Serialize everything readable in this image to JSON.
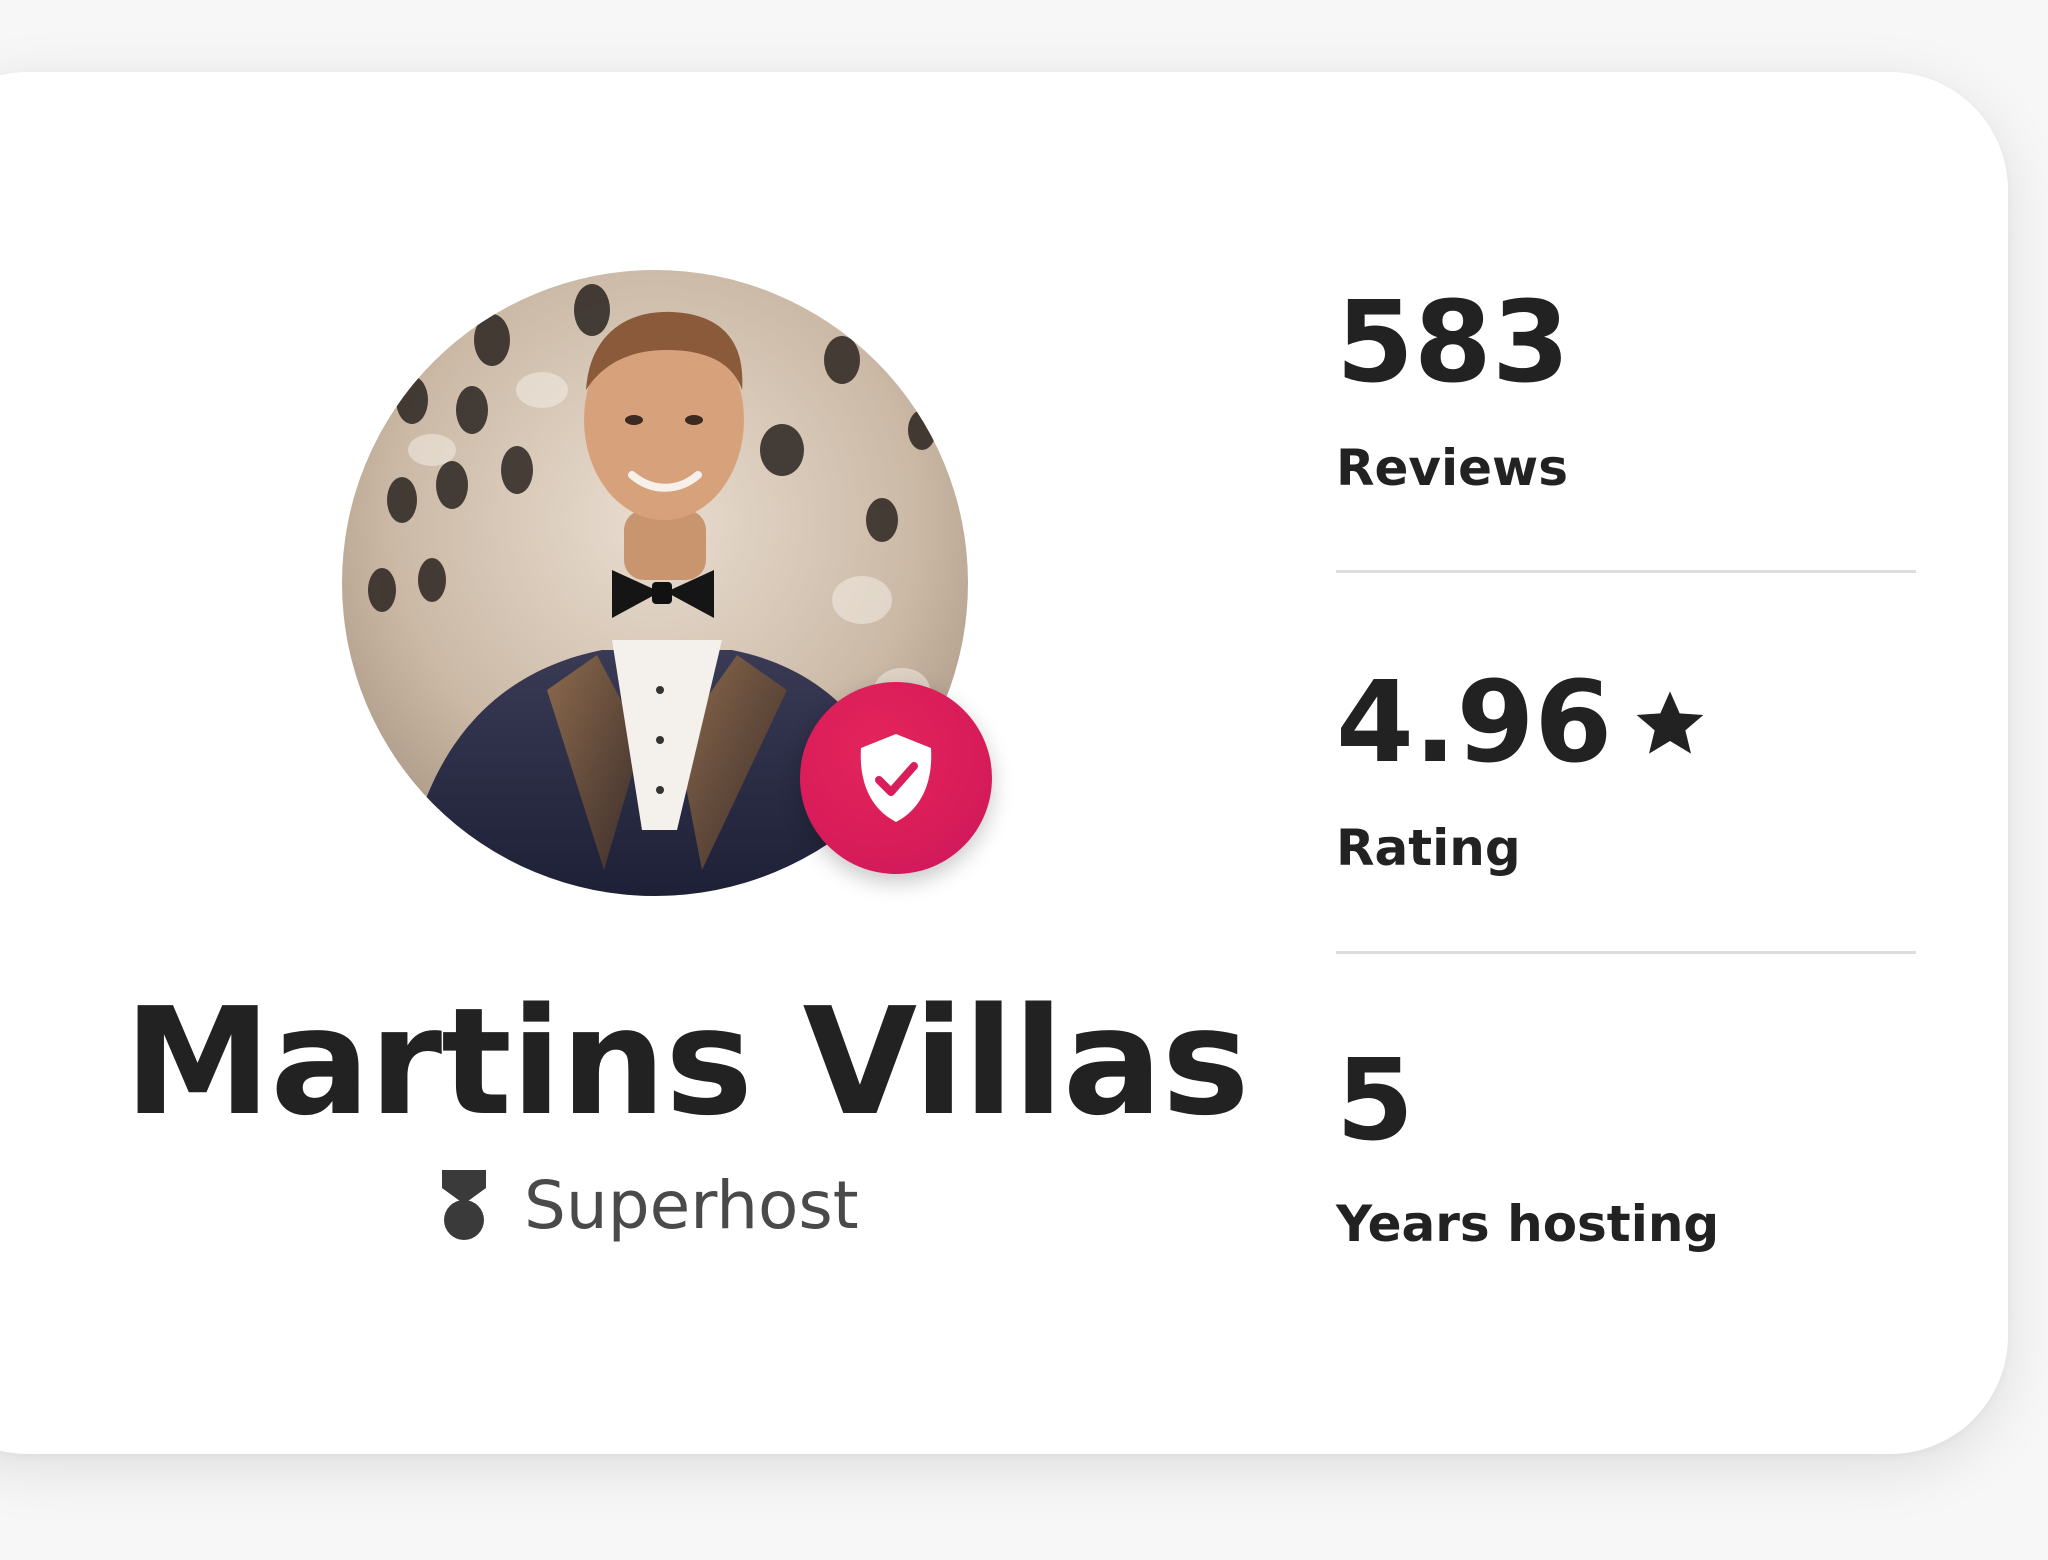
{
  "host": {
    "name": "Martins Villas",
    "badge_label": "Superhost",
    "avatar_icon": "host-photo",
    "verified_icon": "shield-check-icon",
    "accent_color": "#d91e5b"
  },
  "stats": [
    {
      "value": "583",
      "label": "Reviews"
    },
    {
      "value": "4.96",
      "label": "Rating",
      "icon": "star-icon"
    },
    {
      "value": "5",
      "label": "Years hosting"
    }
  ]
}
